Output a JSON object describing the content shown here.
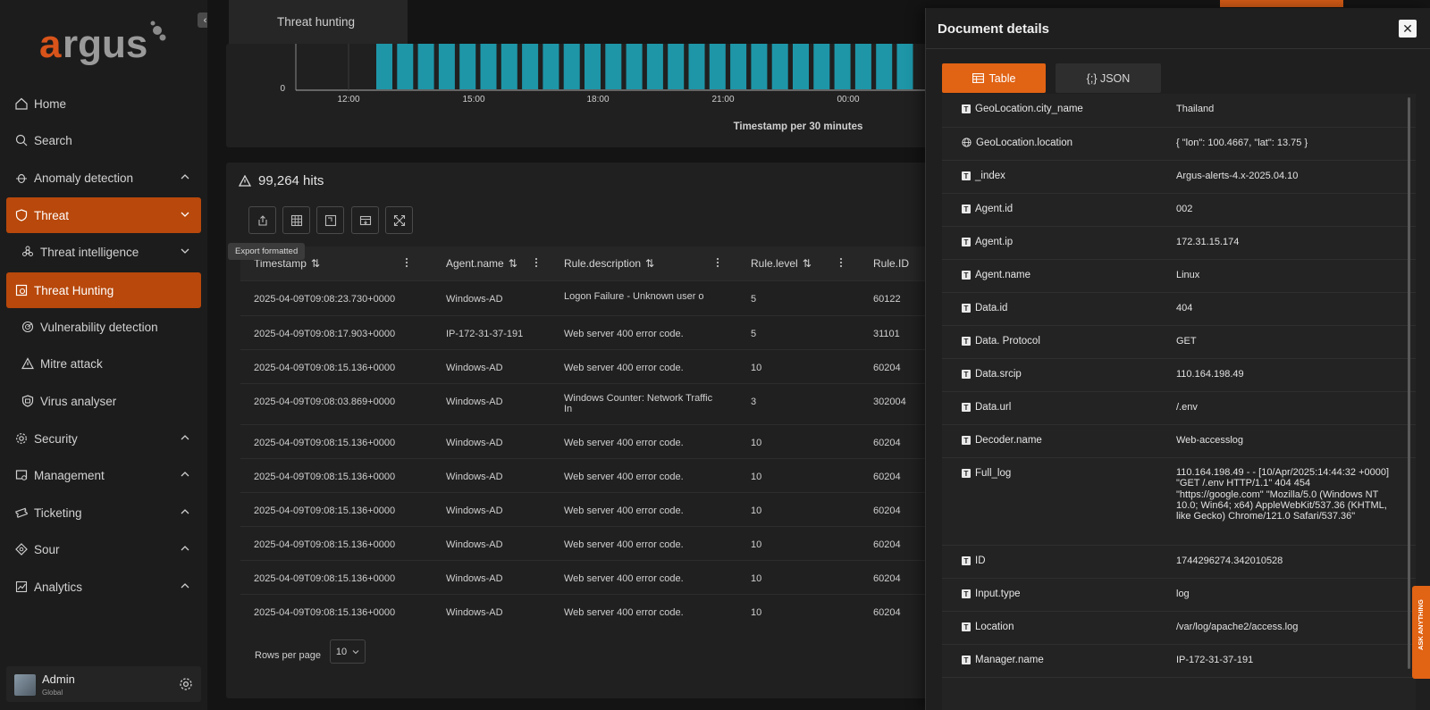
{
  "brand": {
    "name": "argus",
    "accent": "#e16314",
    "active": "#b8480b"
  },
  "sidebar": {
    "collapse_icon": "chevron-left-icon",
    "items": [
      {
        "label": "Home",
        "icon": "home-icon"
      },
      {
        "label": "Search",
        "icon": "search-icon"
      },
      {
        "label": "Anomaly detection",
        "icon": "bug-icon",
        "expanded": true
      },
      {
        "label": "Threat",
        "icon": "shield-icon",
        "active": true
      },
      {
        "label": "Threat intelligence",
        "icon": "biohazard-icon"
      },
      {
        "label": "Threat Hunting",
        "icon": "crosshair-icon",
        "active": true
      },
      {
        "label": "Vulnerability detection",
        "icon": "radar-icon"
      },
      {
        "label": "Mitre attack",
        "icon": "warning-icon"
      },
      {
        "label": "Virus analyser",
        "icon": "shield-virus-icon"
      },
      {
        "label": "Security",
        "icon": "gear-icon"
      },
      {
        "label": "Management",
        "icon": "management-icon"
      },
      {
        "label": "Ticketing",
        "icon": "ticket-icon"
      },
      {
        "label": "Sour",
        "icon": "diamond-icon"
      },
      {
        "label": "Analytics",
        "icon": "chart-icon"
      }
    ],
    "user": {
      "name": "Admin",
      "role": "Global"
    }
  },
  "page": {
    "tab_title": "Threat hunting"
  },
  "histogram": {
    "y_tick": "0",
    "x_ticks": [
      "12:00",
      "15:00",
      "18:00",
      "21:00",
      "00:00"
    ],
    "x_label": "Timestamp per 30 minutes",
    "bar_color": "#1e96a8"
  },
  "hits": {
    "count_text": "99,264 hits",
    "tooltip": "Export formatted",
    "columns": [
      "Timestamp",
      "Agent.name",
      "Rule.description",
      "Rule.level",
      "Rule.ID"
    ],
    "rows": [
      [
        "2025-04-09T09:08:23.730+0000",
        "Windows-AD",
        "Logon Failure - Unknown user o",
        "5",
        "60122"
      ],
      [
        "2025-04-09T09:08:17.903+0000",
        "IP-172-31-37-191",
        "Web server 400 error code.",
        "5",
        "31101"
      ],
      [
        "2025-04-09T09:08:15.136+0000",
        "Windows-AD",
        "Web server 400 error code.",
        "10",
        "60204"
      ],
      [
        "2025-04-09T09:08:03.869+0000",
        "Windows-AD",
        "Windows Counter: Network Traffic In",
        "3",
        "302004"
      ],
      [
        "2025-04-09T09:08:15.136+0000",
        "Windows-AD",
        "Web server 400 error code.",
        "10",
        "60204"
      ],
      [
        "2025-04-09T09:08:15.136+0000",
        "Windows-AD",
        "Web server 400 error code.",
        "10",
        "60204"
      ],
      [
        "2025-04-09T09:08:15.136+0000",
        "Windows-AD",
        "Web server 400 error code.",
        "10",
        "60204"
      ],
      [
        "2025-04-09T09:08:15.136+0000",
        "Windows-AD",
        "Web server 400 error code.",
        "10",
        "60204"
      ],
      [
        "2025-04-09T09:08:15.136+0000",
        "Windows-AD",
        "Web server 400 error code.",
        "10",
        "60204"
      ],
      [
        "2025-04-09T09:08:15.136+0000",
        "Windows-AD",
        "Web server 400 error code.",
        "10",
        "60204"
      ]
    ],
    "rows_per_page_label": "Rows per page",
    "rows_per_page_value": "10"
  },
  "flyout": {
    "title": "Document details",
    "tabs": [
      "Table",
      "{;} JSON"
    ],
    "fields": [
      {
        "key": "GeoLocation.city_name",
        "value": "Thailand",
        "type": "T"
      },
      {
        "key": "GeoLocation.location",
        "value": "{ \"lon\": 100.4667, \"lat\": 13.75 }",
        "type": "geo"
      },
      {
        "key": "_index",
        "value": "Argus-alerts-4.x-2025.04.10",
        "type": "T"
      },
      {
        "key": "Agent.id",
        "value": "002",
        "type": "T"
      },
      {
        "key": "Agent.ip",
        "value": "172.31.15.174",
        "type": "T"
      },
      {
        "key": "Agent.name",
        "value": "Linux",
        "type": "T"
      },
      {
        "key": "Data.id",
        "value": "404",
        "type": "T"
      },
      {
        "key": "Data. Protocol",
        "value": "GET",
        "type": "T"
      },
      {
        "key": "Data.srcip",
        "value": "110.164.198.49",
        "type": "T"
      },
      {
        "key": "Data.url",
        "value": "/.env",
        "type": "T"
      },
      {
        "key": "Decoder.name",
        "value": "Web-accesslog",
        "type": "T"
      },
      {
        "key": "Full_log",
        "value": "110.164.198.49 - - [10/Apr/2025:14:44:32 +0000] \"GET /.env HTTP/1.1\" 404 454 \"https://google.com\" \"Mozilla/5.0 (Windows NT 10.0; Win64; x64) AppleWebKit/537.36 (KHTML, like Gecko) Chrome/121.0 Safari/537.36\"",
        "type": "T"
      },
      {
        "key": "ID",
        "value": "1744296274.342010528",
        "type": "T"
      },
      {
        "key": "Input.type",
        "value": "log",
        "type": "T"
      },
      {
        "key": "Location",
        "value": "/var/log/apache2/access.log",
        "type": "T"
      },
      {
        "key": "Manager.name",
        "value": "IP-172-31-37-191",
        "type": "T"
      }
    ],
    "ask_label": "ASK ANYTHING"
  }
}
